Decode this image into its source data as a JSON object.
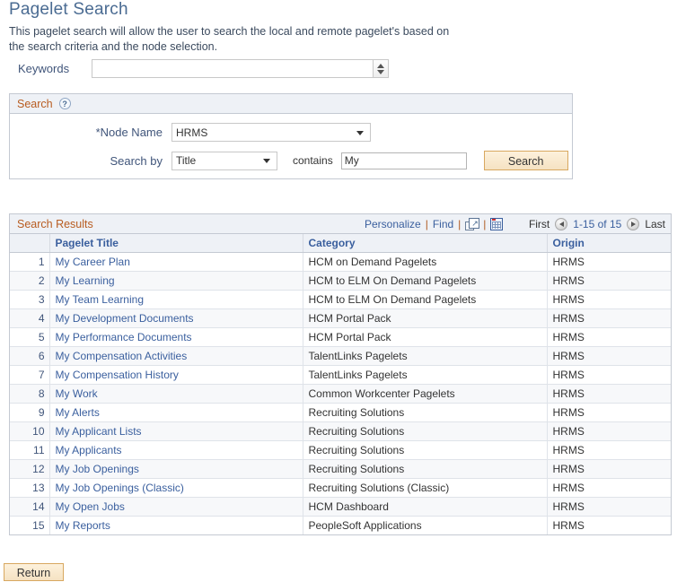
{
  "page": {
    "title": "Pagelet Search",
    "description": "This pagelet search will allow the user to search the local and remote pagelet's based on the search criteria and the node selection."
  },
  "keywords": {
    "label": "Keywords",
    "value": "",
    "placeholder": ""
  },
  "search_panel": {
    "title": "Search",
    "help_icon": "question-mark-icon",
    "node_name": {
      "label": "*Node Name",
      "value": "HRMS"
    },
    "search_by": {
      "label": "Search by",
      "value": "Title",
      "operator_label": "contains",
      "term_value": "My"
    },
    "search_button": "Search"
  },
  "results": {
    "title": "Search Results",
    "tools": {
      "personalize": "Personalize",
      "find": "Find",
      "separator": "|",
      "new_window_icon": "new-window-icon",
      "download_grid_icon": "download-to-spreadsheet-icon"
    },
    "pager": {
      "first": "First",
      "prev_icon": "previous-page-icon",
      "range": "1-15 of 15",
      "next_icon": "next-page-icon",
      "last": "Last"
    },
    "columns": {
      "num": "",
      "title": "Pagelet Title",
      "category": "Category",
      "origin": "Origin"
    },
    "rows": [
      {
        "num": "1",
        "title": "My Career Plan",
        "category": "HCM on Demand Pagelets",
        "origin": "HRMS"
      },
      {
        "num": "2",
        "title": "My Learning",
        "category": "HCM to ELM On Demand Pagelets",
        "origin": "HRMS"
      },
      {
        "num": "3",
        "title": "My Team Learning",
        "category": "HCM to ELM On Demand Pagelets",
        "origin": "HRMS"
      },
      {
        "num": "4",
        "title": "My Development Documents",
        "category": "HCM Portal Pack",
        "origin": "HRMS"
      },
      {
        "num": "5",
        "title": "My Performance Documents",
        "category": "HCM Portal Pack",
        "origin": "HRMS"
      },
      {
        "num": "6",
        "title": "My Compensation Activities",
        "category": "TalentLinks Pagelets",
        "origin": "HRMS"
      },
      {
        "num": "7",
        "title": "My Compensation History",
        "category": "TalentLinks Pagelets",
        "origin": "HRMS"
      },
      {
        "num": "8",
        "title": "My Work",
        "category": "Common Workcenter Pagelets",
        "origin": "HRMS"
      },
      {
        "num": "9",
        "title": "My Alerts",
        "category": "Recruiting Solutions",
        "origin": "HRMS"
      },
      {
        "num": "10",
        "title": "My Applicant Lists",
        "category": "Recruiting Solutions",
        "origin": "HRMS"
      },
      {
        "num": "11",
        "title": "My Applicants",
        "category": "Recruiting Solutions",
        "origin": "HRMS"
      },
      {
        "num": "12",
        "title": "My Job Openings",
        "category": "Recruiting Solutions",
        "origin": "HRMS"
      },
      {
        "num": "13",
        "title": "My Job Openings (Classic)",
        "category": "Recruiting Solutions (Classic)",
        "origin": "HRMS"
      },
      {
        "num": "14",
        "title": "My Open Jobs",
        "category": "HCM Dashboard",
        "origin": "HRMS"
      },
      {
        "num": "15",
        "title": "My Reports",
        "category": "PeopleSoft Applications",
        "origin": "HRMS"
      }
    ]
  },
  "footer": {
    "return_button": "Return"
  },
  "colors": {
    "title_blue": "#4a6b92",
    "link_blue": "#3a5f9e",
    "panel_header_bg": "#eef1f6",
    "section_orange": "#b85c20",
    "button_tan": "#f5e2c2",
    "button_border": "#d8a860"
  }
}
